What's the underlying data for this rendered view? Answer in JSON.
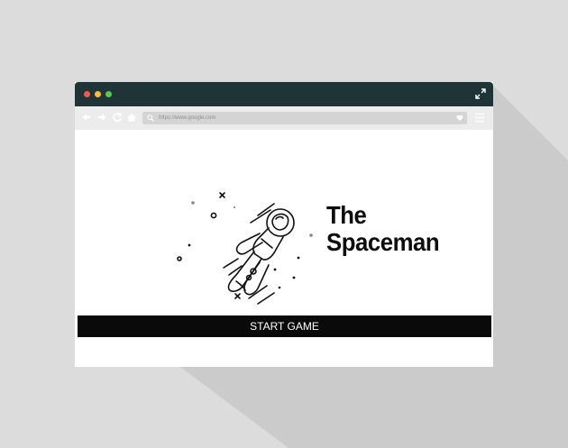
{
  "browser": {
    "url": "https://www.google.com",
    "icons": {
      "expand": "expand-icon",
      "back": "arrow-left-icon",
      "forward": "arrow-right-icon",
      "reload": "reload-icon",
      "home": "home-icon",
      "search": "search-icon",
      "favorite": "heart-icon",
      "menu": "menu-icon"
    },
    "colors": {
      "titlebar": "#1f3436",
      "close": "#f2594b",
      "minimize": "#f6bd3b",
      "maximize": "#5fc254",
      "toolbar": "#ececec"
    }
  },
  "game": {
    "title_line1": "The",
    "title_line2": "Spaceman",
    "start_label": "START GAME",
    "illustration": "astronaut-illustration"
  }
}
